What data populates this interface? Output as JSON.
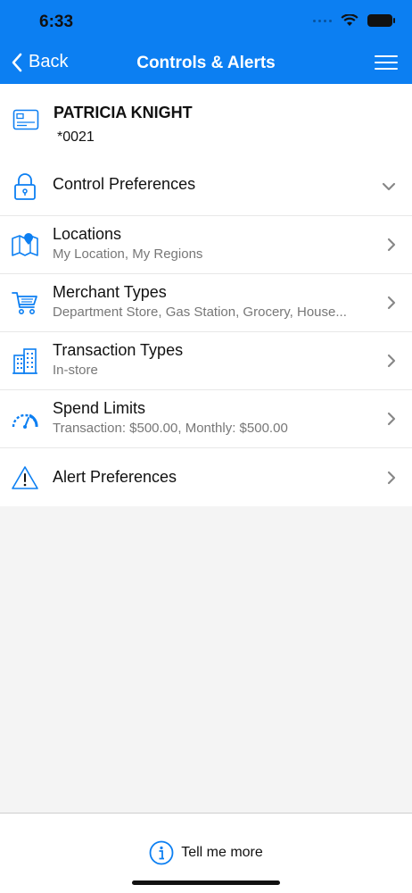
{
  "status_bar": {
    "time": "6:33"
  },
  "nav": {
    "back_label": "Back",
    "title": "Controls & Alerts"
  },
  "card": {
    "holder": "PATRICIA KNIGHT",
    "number": "*0021"
  },
  "sections": [
    {
      "icon": "lock-icon",
      "title": "Control Preferences",
      "subtitle": "",
      "chevron": "down"
    },
    {
      "icon": "map-pin-icon",
      "title": "Locations",
      "subtitle": "My Location, My Regions",
      "chevron": "right"
    },
    {
      "icon": "cart-icon",
      "title": "Merchant Types",
      "subtitle": "Department Store, Gas Station, Grocery, House...",
      "chevron": "right"
    },
    {
      "icon": "building-icon",
      "title": "Transaction Types",
      "subtitle": "In-store",
      "chevron": "right"
    },
    {
      "icon": "gauge-icon",
      "title": "Spend Limits",
      "subtitle": "Transaction: $500.00, Monthly: $500.00",
      "chevron": "right"
    },
    {
      "icon": "warning-icon",
      "title": "Alert Preferences",
      "subtitle": "",
      "chevron": "right"
    }
  ],
  "footer": {
    "info_label": "Tell me more"
  },
  "colors": {
    "accent": "#0c7ff2",
    "background": "#f4f4f4"
  }
}
